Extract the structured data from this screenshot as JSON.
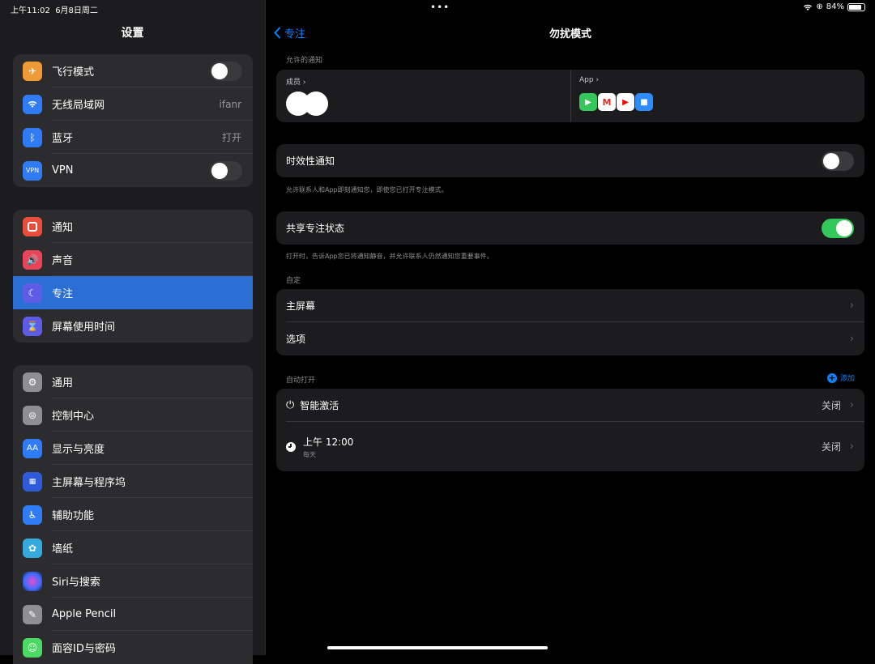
{
  "status": {
    "time": "上午11:02",
    "date": "6月8日周二",
    "battery": "84%"
  },
  "sidebar": {
    "title": "设置",
    "group1": [
      {
        "label": "飞行模式",
        "icon": "airplane-icon",
        "color": "#f09a37",
        "toggle": false
      },
      {
        "label": "无线局域网",
        "icon": "wifi-icon",
        "color": "#2f7cf6",
        "value": "ifanr"
      },
      {
        "label": "蓝牙",
        "icon": "bluetooth-icon",
        "color": "#2f7cf6",
        "value": "打开"
      },
      {
        "label": "VPN",
        "icon": "vpn-icon",
        "color": "#2f7cf6",
        "toggle": false,
        "icon_text": "VPN"
      }
    ],
    "group2": [
      {
        "label": "通知",
        "icon": "notifications-icon",
        "color": "#eb4d3d"
      },
      {
        "label": "声音",
        "icon": "sound-icon",
        "color": "#eb445a"
      },
      {
        "label": "专注",
        "icon": "moon-icon",
        "color": "#5e5ce6",
        "selected": true
      },
      {
        "label": "屏幕使用时间",
        "icon": "hourglass-icon",
        "color": "#5e5ce6"
      }
    ],
    "group3": [
      {
        "label": "通用",
        "icon": "gear-icon",
        "color": "#8e8e93"
      },
      {
        "label": "控制中心",
        "icon": "control-center-icon",
        "color": "#8e8e93"
      },
      {
        "label": "显示与亮度",
        "icon": "display-icon",
        "color": "#2f7cf6",
        "icon_text": "AA"
      },
      {
        "label": "主屏幕与程序坞",
        "icon": "home-screen-icon",
        "color": "#2f5bd8"
      },
      {
        "label": "辅助功能",
        "icon": "accessibility-icon",
        "color": "#2f7cf6"
      },
      {
        "label": "墙纸",
        "icon": "wallpaper-icon",
        "color": "#35aadc"
      },
      {
        "label": "Siri与搜索",
        "icon": "siri-icon",
        "color": "#222"
      },
      {
        "label": "Apple Pencil",
        "icon": "pencil-icon",
        "color": "#8e8e93"
      },
      {
        "label": "面容ID与密码",
        "icon": "faceid-icon",
        "color": "#4cd964"
      }
    ]
  },
  "main": {
    "back": "专注",
    "title": "勿扰模式",
    "allowed_header": "允许的通知",
    "people_label": "成员",
    "apps_label": "App",
    "time_sensitive": {
      "label": "时效性通知",
      "toggle": false,
      "note": "允许联系人和App即刻通知您，即使您已打开专注模式。"
    },
    "share_status": {
      "label": "共享专注状态",
      "toggle": true,
      "note": "打开时，告诉App您已将通知静音，并允许联系人仍然通知您重要事件。"
    },
    "customize_header": "自定",
    "customize": [
      {
        "label": "主屏幕"
      },
      {
        "label": "选项"
      }
    ],
    "auto_header": "自动打开",
    "add_label": "添加",
    "auto": [
      {
        "label": "智能激活",
        "value": "关闭",
        "icon": "power-icon"
      },
      {
        "label": "上午 12:00",
        "sub": "每天",
        "value": "关闭",
        "icon": "clock-icon"
      }
    ]
  },
  "colors": {
    "accent": "#0a84ff",
    "toggle_on": "#34c759",
    "selected": "#2b6fd5"
  }
}
